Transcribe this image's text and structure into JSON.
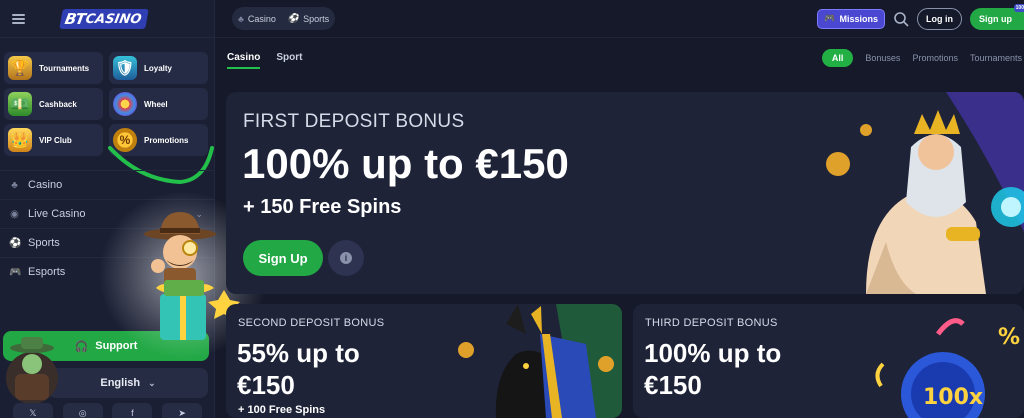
{
  "brand": {
    "logo_bt": "BT",
    "logo_text": "CASINO"
  },
  "sidebar": {
    "promo_tiles": [
      {
        "label": "Tournaments",
        "icon": "trophy-icon"
      },
      {
        "label": "Loyalty",
        "icon": "shield-icon"
      },
      {
        "label": "Cashback",
        "icon": "cash-icon"
      },
      {
        "label": "Wheel",
        "icon": "wheel-icon"
      },
      {
        "label": "VIP Club",
        "icon": "crown-icon"
      },
      {
        "label": "Promotions",
        "icon": "percent-icon"
      }
    ],
    "nav": [
      {
        "label": "Casino",
        "icon": "casino-icon"
      },
      {
        "label": "Live Casino",
        "icon": "live-icon"
      },
      {
        "label": "Sports",
        "icon": "ball-icon"
      },
      {
        "label": "Esports",
        "icon": "gamepad-icon"
      }
    ],
    "support_label": "Support",
    "language": "English"
  },
  "header": {
    "switch": [
      "Casino",
      "Sports"
    ],
    "missions_label": "Missions",
    "login_label": "Log in",
    "signup_label": "Sign up",
    "signup_badge": "100"
  },
  "subnav": {
    "categories": [
      "Casino",
      "Sport"
    ],
    "filters": [
      "All",
      "Bonuses",
      "Promotions",
      "Tournaments"
    ]
  },
  "hero": {
    "kicker": "FIRST DEPOSIT BONUS",
    "headline": "100% up to €150",
    "sub": "+ 150 Free Spins",
    "cta": "Sign Up"
  },
  "cards": [
    {
      "kicker": "SECOND DEPOSIT BONUS",
      "big": "55% up to €150",
      "small": "+ 100 Free Spins"
    },
    {
      "kicker": "THIRD DEPOSIT BONUS",
      "big": "100% up to €150"
    }
  ],
  "colors": {
    "accent_green": "#22a845",
    "missions_purple": "#4a48d0",
    "background": "#151929",
    "panel": "#1e2338"
  }
}
